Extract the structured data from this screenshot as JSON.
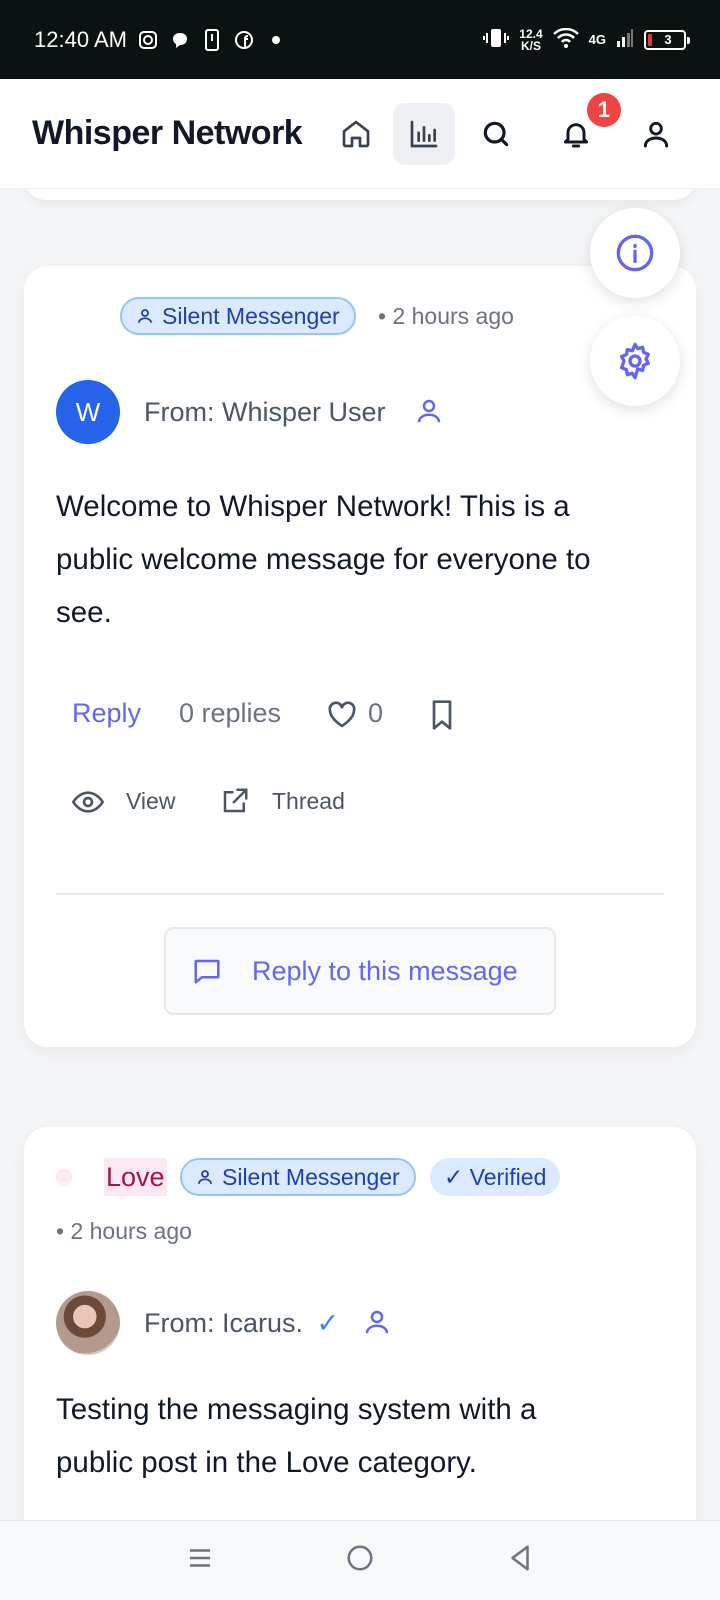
{
  "status_bar": {
    "time": "12:40 AM",
    "speed_value": "12.4",
    "speed_unit": "K/S",
    "network": "4G",
    "battery": "3"
  },
  "header": {
    "title": "Whisper Network",
    "notification_count": "1",
    "nav_items": [
      "home-icon",
      "chart-icon",
      "search-icon",
      "bell-icon",
      "user-icon"
    ]
  },
  "fabs": [
    "info-icon",
    "gear-icon"
  ],
  "posts": [
    {
      "badge": "Silent Messenger",
      "time": "• 2 hours ago",
      "avatar_initial": "W",
      "from": "From: Whisper User",
      "body_lines": [
        "Welcome to Whisper Network! This is a",
        "public welcome message for everyone to",
        "see."
      ],
      "reply_label": "Reply",
      "replies": "0 replies",
      "likes": "0",
      "view_label": "View",
      "thread_label": "Thread",
      "reply_button": "Reply to this message"
    },
    {
      "category": "Love",
      "badge": "Silent Messenger",
      "verified": "✓ Verified",
      "time": "• 2 hours ago",
      "from": "From: Icarus.",
      "from_check": "✓",
      "body_lines": [
        "Testing the messaging system with a",
        "public post in the Love category."
      ]
    }
  ],
  "colors": {
    "accent": "#6366f1",
    "badge_bg": "#dbeafe",
    "badge_text": "#1e40af",
    "avatar_blue": "#2563eb",
    "notif_red": "#ef4444",
    "love_bg": "#fce7f3",
    "love_text": "#9d174d"
  }
}
